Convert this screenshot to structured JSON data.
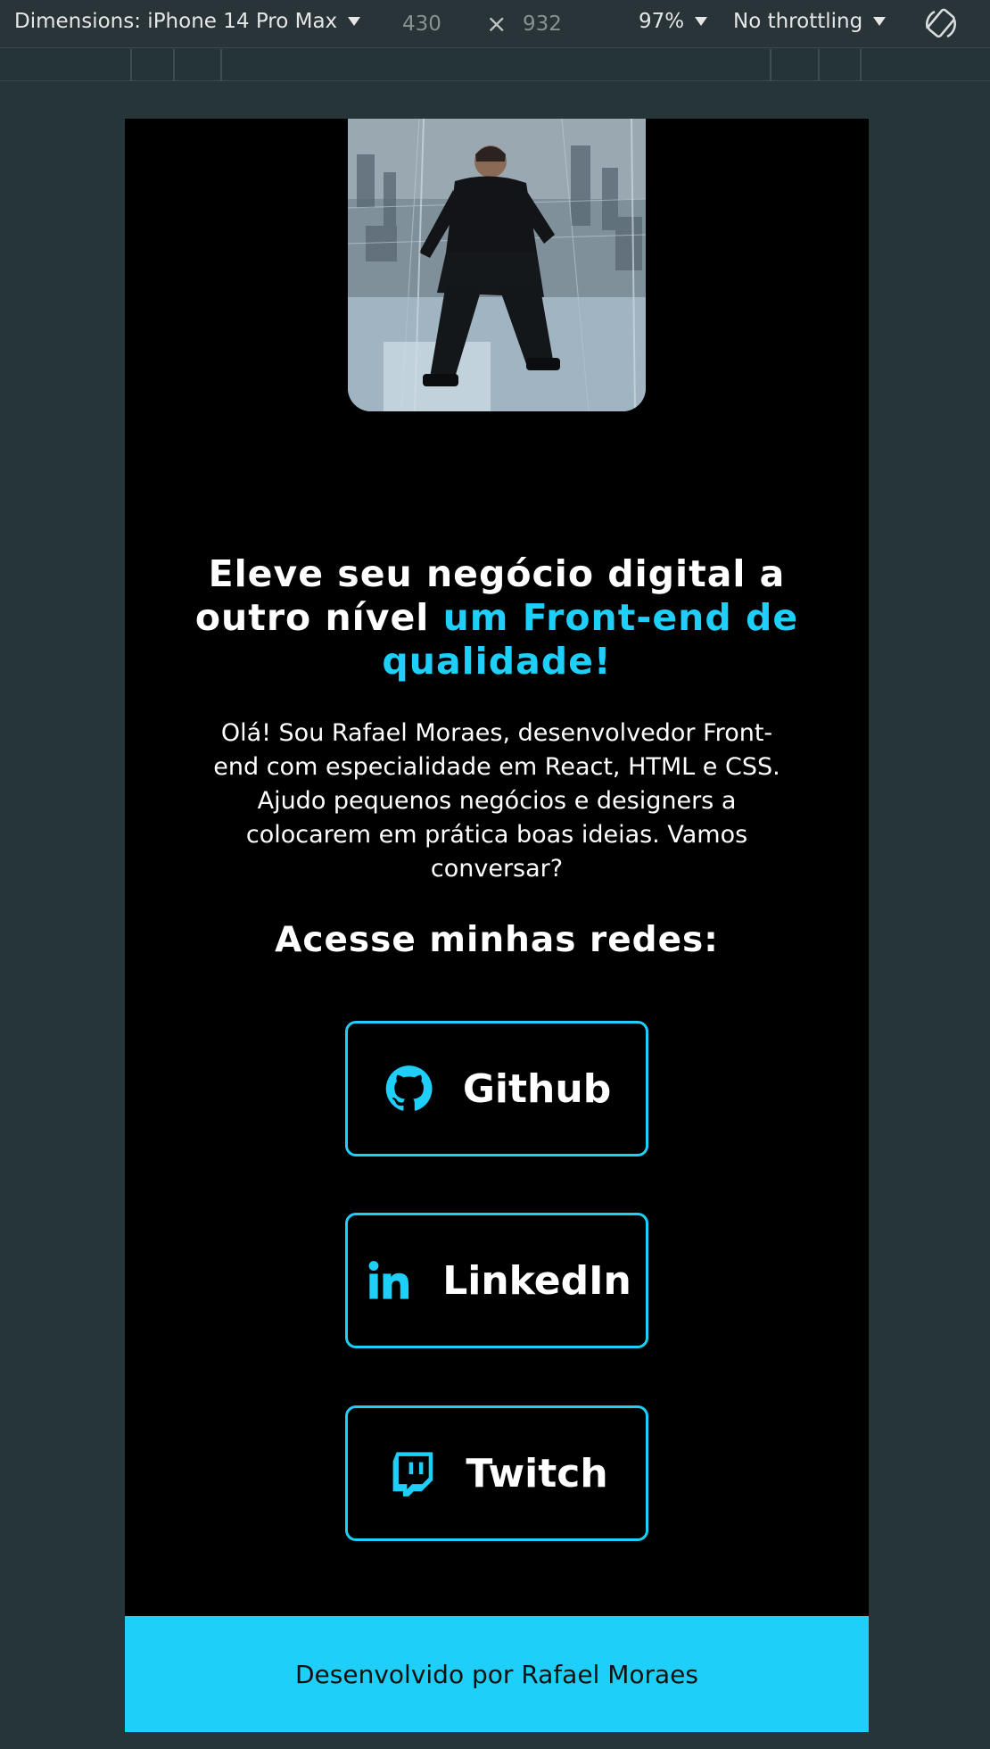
{
  "devtools": {
    "dimensions_label": "Dimensions: iPhone 14 Pro Max",
    "width_value": "430",
    "height_value": "932",
    "times": "×",
    "zoom": "97%",
    "throttling": "No throttling"
  },
  "page": {
    "headline_part1": "Eleve seu negócio digital a outro nível ",
    "headline_accent": "um Front-end de qualidade!",
    "intro": "Olá! Sou Rafael Moraes, desenvolvedor Front-end com especialidade em React, HTML e CSS. Ajudo pequenos negócios e designers a colocarem em prática boas ideias. Vamos conversar?",
    "networks_title": "Acesse minhas redes:",
    "social": [
      {
        "label": "Github",
        "icon": "github-icon"
      },
      {
        "label": "LinkedIn",
        "icon": "linkedin-icon"
      },
      {
        "label": "Twitch",
        "icon": "twitch-icon"
      }
    ],
    "footer": "Desenvolvido por Rafael Moraes"
  },
  "colors": {
    "accent": "#1ecff9",
    "page_bg": "#000000",
    "devtools_bg": "#253538"
  }
}
